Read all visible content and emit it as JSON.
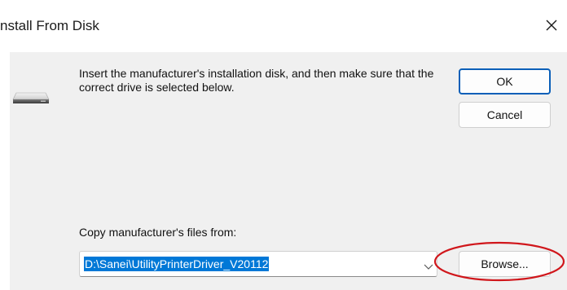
{
  "window": {
    "title": "nstall From Disk",
    "close_icon": "close-icon"
  },
  "instructions": "Insert the manufacturer's installation disk, and then make sure that the correct drive is selected below.",
  "buttons": {
    "ok": "OK",
    "cancel": "Cancel",
    "browse": "Browse..."
  },
  "copy_from": {
    "label": "Copy manufacturer's files from:",
    "value": "D:\\Sanei\\UtilityPrinterDriver_V20112",
    "selected": true
  },
  "icons": {
    "drive": "disk-drive-icon",
    "dropdown": "chevron-down-icon"
  },
  "colors": {
    "selection": "#0078d7",
    "default_button_border": "#0a5fb8",
    "annotation": "#d0161b",
    "client_background": "#f0f0f0"
  }
}
